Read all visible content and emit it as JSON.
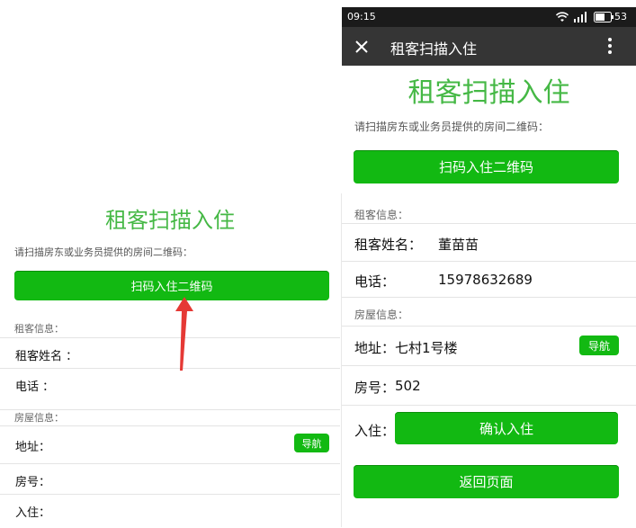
{
  "left_screen": {
    "title": "租客扫描入住",
    "hint": "请扫描房东或业务员提供的房间二维码：",
    "scan_button": "扫码入住二维码",
    "tenant_section": "租客信息：",
    "name_label": "租客姓名 ：",
    "phone_label": "电话 ：",
    "house_section": "房屋信息：",
    "address_label": "地址：",
    "nav_button": "导航",
    "room_label": "房号：",
    "checkin_label": "入住："
  },
  "right_screen": {
    "status": {
      "time": "09:15",
      "battery": "53"
    },
    "titlebar": {
      "title": "租客扫描入住"
    },
    "title": "租客扫描入住",
    "hint": "请扫描房东或业务员提供的房间二维码：",
    "scan_button": "扫码入住二维码",
    "tenant_section": "租客信息：",
    "name_label": "租客姓名：",
    "name_value": "董苗苗",
    "phone_label": "电话：",
    "phone_value": "15978632689",
    "house_section": "房屋信息：",
    "address_label": "地址：",
    "address_value": "七村1号楼",
    "nav_button": "导航",
    "room_label": "房号：",
    "room_value": "502",
    "checkin_label": "入住：",
    "confirm_button": "确认入住",
    "back_button": "返回页面"
  },
  "colors": {
    "accent_green": "#12b912",
    "title_green": "#45b845",
    "titlebar": "#353535",
    "arrow_red": "#e53935"
  }
}
